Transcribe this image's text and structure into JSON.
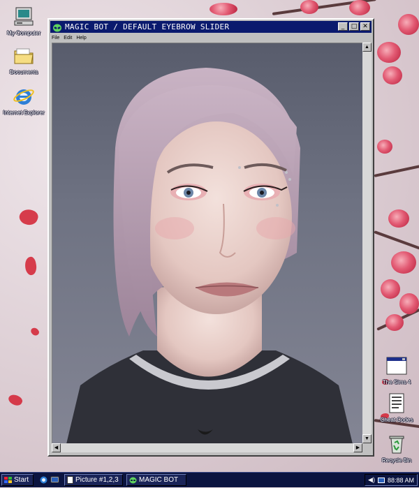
{
  "desktop": {
    "icons_left": [
      {
        "label": "My Computer",
        "icon": "computer-icon"
      },
      {
        "label": "Documents",
        "icon": "folder-icon"
      },
      {
        "label": "Internet Explorer",
        "icon": "internet-explorer-icon"
      }
    ],
    "icons_right": [
      {
        "label": "The Sims 4",
        "icon": "window-app-icon"
      },
      {
        "label": "Cheat Codes",
        "icon": "text-document-icon"
      },
      {
        "label": "Recycle Bin",
        "icon": "recycle-bin-icon"
      }
    ]
  },
  "window": {
    "title": "MAGIC BOT / DEFAULT EYEBROW SLIDER",
    "title_icon": "alien-head-icon",
    "menu": [
      "File",
      "Edit",
      "Help"
    ],
    "buttons": {
      "minimize": "_",
      "maximize": "□",
      "close": "✕"
    }
  },
  "taskbar": {
    "start_label": "Start",
    "quick_launch": [
      "ie-icon",
      "desktop-icon"
    ],
    "tasks": [
      {
        "label": "Picture #1,2,3",
        "icon": "image-document-icon"
      },
      {
        "label": "MAGIC BOT",
        "icon": "alien-head-icon"
      }
    ],
    "clock": "88:88 AM"
  },
  "colors": {
    "titlebar": "#0a1a6e",
    "taskbar": "#0b1440",
    "blossom": "#d42a3b",
    "window_chrome": "#c0c0c0"
  }
}
